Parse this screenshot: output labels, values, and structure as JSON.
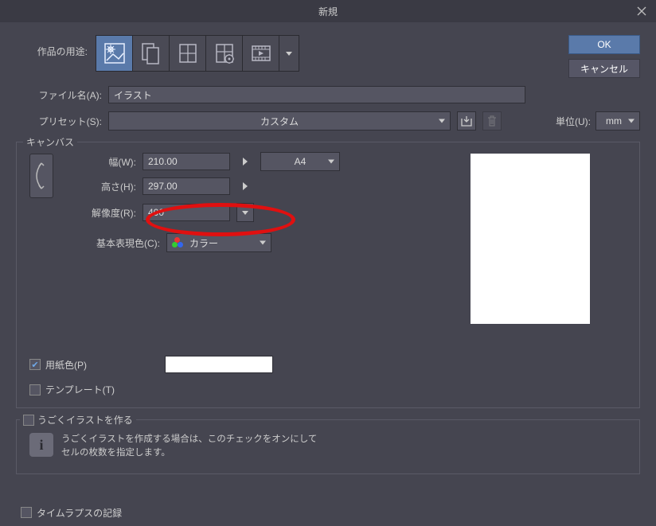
{
  "window": {
    "title": "新規"
  },
  "buttons": {
    "ok": "OK",
    "cancel": "キャンセル"
  },
  "labels": {
    "usage": "作品の用途:",
    "filename": "ファイル名(A):",
    "preset": "プリセット(S):",
    "unit": "単位(U):",
    "canvas_legend": "キャンバス",
    "width": "幅(W):",
    "height": "高さ(H):",
    "resolution": "解像度(R):",
    "basic_color": "基本表現色(C):",
    "paper_color": "用紙色(P)",
    "template": "テンプレート(T)",
    "animate_legend": "うごくイラストを作る",
    "timelapse": "タイムラプスの記録"
  },
  "values": {
    "filename": "イラスト",
    "preset": "カスタム",
    "unit": "mm",
    "width": "210.00",
    "height": "297.00",
    "resolution": "400",
    "size_preset": "A4",
    "color_mode": "カラー"
  },
  "info": {
    "animate": "うごくイラストを作成する場合は、このチェックをオンにして\nセルの枚数を指定します。"
  },
  "checks": {
    "paper_color": true,
    "template": false,
    "animate": false,
    "timelapse": false
  }
}
